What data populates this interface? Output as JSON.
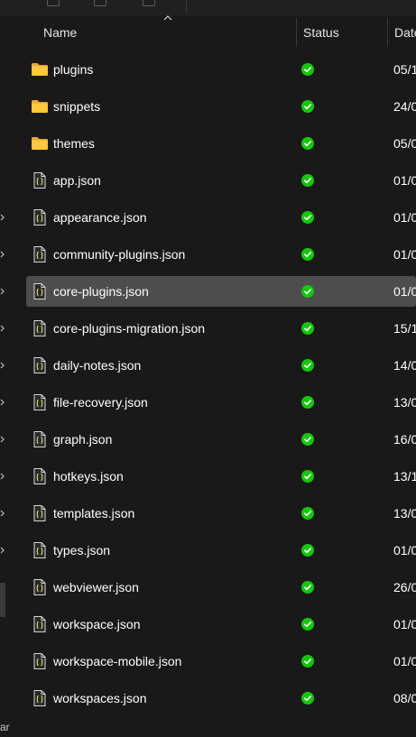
{
  "columns": {
    "name": "Name",
    "status": "Status",
    "date": "Date"
  },
  "nav": {
    "bottom_text": "ar"
  },
  "files": [
    {
      "name": "plugins",
      "type": "folder",
      "status": "synced",
      "date": "05/1"
    },
    {
      "name": "snippets",
      "type": "folder",
      "status": "synced",
      "date": "24/0"
    },
    {
      "name": "themes",
      "type": "folder",
      "status": "synced",
      "date": "05/0"
    },
    {
      "name": "app.json",
      "type": "json",
      "status": "synced",
      "date": "01/0"
    },
    {
      "name": "appearance.json",
      "type": "json",
      "status": "synced",
      "date": "01/0"
    },
    {
      "name": "community-plugins.json",
      "type": "json",
      "status": "synced",
      "date": "01/0"
    },
    {
      "name": "core-plugins.json",
      "type": "json",
      "status": "synced",
      "date": "01/0",
      "selected": true
    },
    {
      "name": "core-plugins-migration.json",
      "type": "json",
      "status": "synced",
      "date": "15/1"
    },
    {
      "name": "daily-notes.json",
      "type": "json",
      "status": "synced",
      "date": "14/0"
    },
    {
      "name": "file-recovery.json",
      "type": "json",
      "status": "synced",
      "date": "13/0"
    },
    {
      "name": "graph.json",
      "type": "json",
      "status": "synced",
      "date": "16/0"
    },
    {
      "name": "hotkeys.json",
      "type": "json",
      "status": "synced",
      "date": "13/1"
    },
    {
      "name": "templates.json",
      "type": "json",
      "status": "synced",
      "date": "13/0"
    },
    {
      "name": "types.json",
      "type": "json",
      "status": "synced",
      "date": "01/0"
    },
    {
      "name": "webviewer.json",
      "type": "json",
      "status": "synced",
      "date": "26/0"
    },
    {
      "name": "workspace.json",
      "type": "json",
      "status": "synced",
      "date": "01/0"
    },
    {
      "name": "workspace-mobile.json",
      "type": "json",
      "status": "synced",
      "date": "01/0"
    },
    {
      "name": "workspaces.json",
      "type": "json",
      "status": "synced",
      "date": "08/0"
    }
  ],
  "icons": {
    "folder": "folder-icon",
    "json": "json-file-icon",
    "status": "green-check-icon",
    "sort": "sort-ascending-icon"
  },
  "colors": {
    "background": "#191919",
    "selected_row": "#4d4d4d",
    "status_green": "#16c60c",
    "folder_yellow": "#ffc83d"
  }
}
